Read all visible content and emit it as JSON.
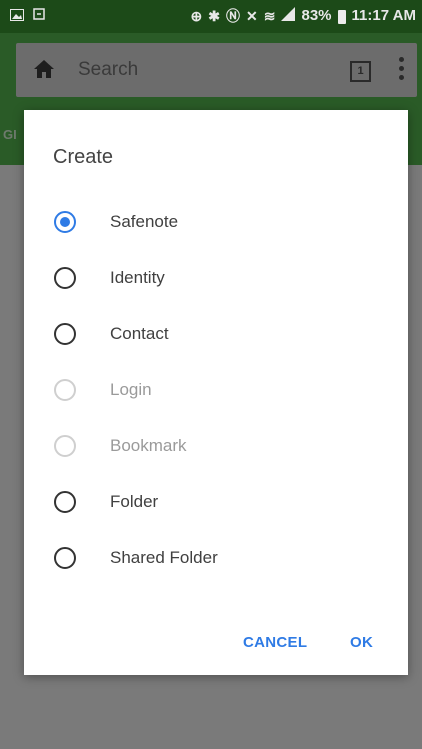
{
  "status_bar": {
    "battery": "83%",
    "time": "11:17 AM"
  },
  "app_bar": {
    "search_placeholder": "Search",
    "tab_count": "1",
    "tab_fragment": "GI"
  },
  "dialog": {
    "title": "Create",
    "options": [
      {
        "label": "Safenote",
        "checked": true,
        "enabled": true
      },
      {
        "label": "Identity",
        "checked": false,
        "enabled": true
      },
      {
        "label": "Contact",
        "checked": false,
        "enabled": true
      },
      {
        "label": "Login",
        "checked": false,
        "enabled": false
      },
      {
        "label": "Bookmark",
        "checked": false,
        "enabled": false
      },
      {
        "label": "Folder",
        "checked": false,
        "enabled": true
      },
      {
        "label": "Shared Folder",
        "checked": false,
        "enabled": true
      }
    ],
    "cancel_label": "CANCEL",
    "ok_label": "OK"
  },
  "colors": {
    "accent": "#2f7be5",
    "status_bar_bg": "#1c4a18",
    "dim_overlay": "#7a7a7a"
  },
  "icons": {
    "status_left": [
      "image-icon",
      "screenshot-icon"
    ],
    "status_right": [
      "data-saver-icon",
      "bluetooth-icon",
      "nfc-icon",
      "mute-icon",
      "wifi-icon",
      "signal-icon",
      "battery-icon"
    ],
    "app_bar": [
      "home-icon",
      "tabs-icon",
      "more-icon"
    ]
  }
}
